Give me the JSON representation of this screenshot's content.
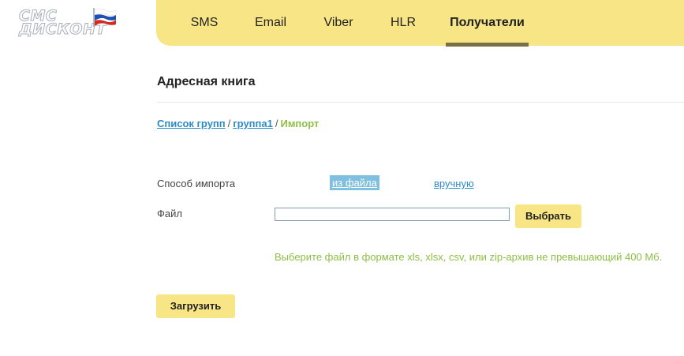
{
  "logo": {
    "line1": "СМС",
    "line2": "ДИСКОНТ",
    "flag_colors": [
      "#ffffff",
      "#1e4fb4",
      "#d52b1e"
    ]
  },
  "nav": {
    "items": [
      {
        "label": "SMS"
      },
      {
        "label": "Email"
      },
      {
        "label": "Viber"
      },
      {
        "label": "HLR"
      },
      {
        "label": "Получатели",
        "active": true
      }
    ]
  },
  "page": {
    "title": "Адресная книга"
  },
  "breadcrumb": {
    "items": [
      {
        "label": "Список групп"
      },
      {
        "label": "группа1"
      },
      {
        "label": "Импорт"
      }
    ],
    "separator": "/"
  },
  "form": {
    "import_method_label": "Способ импорта",
    "method_options": [
      {
        "label": "из файла",
        "selected": true
      },
      {
        "label": "вручную",
        "selected": false
      }
    ],
    "file_label": "Файл",
    "file_value": "",
    "choose_button": "Выбрать",
    "hint": "Выберите файл в формате xls, xlsx, csv, или zip-архив не превышающий 400 Мб.",
    "upload_button": "Загрузить"
  },
  "colors": {
    "accent_yellow": "#f8e585",
    "link_blue": "#2b8bc6",
    "hint_green": "#8dbf43"
  }
}
